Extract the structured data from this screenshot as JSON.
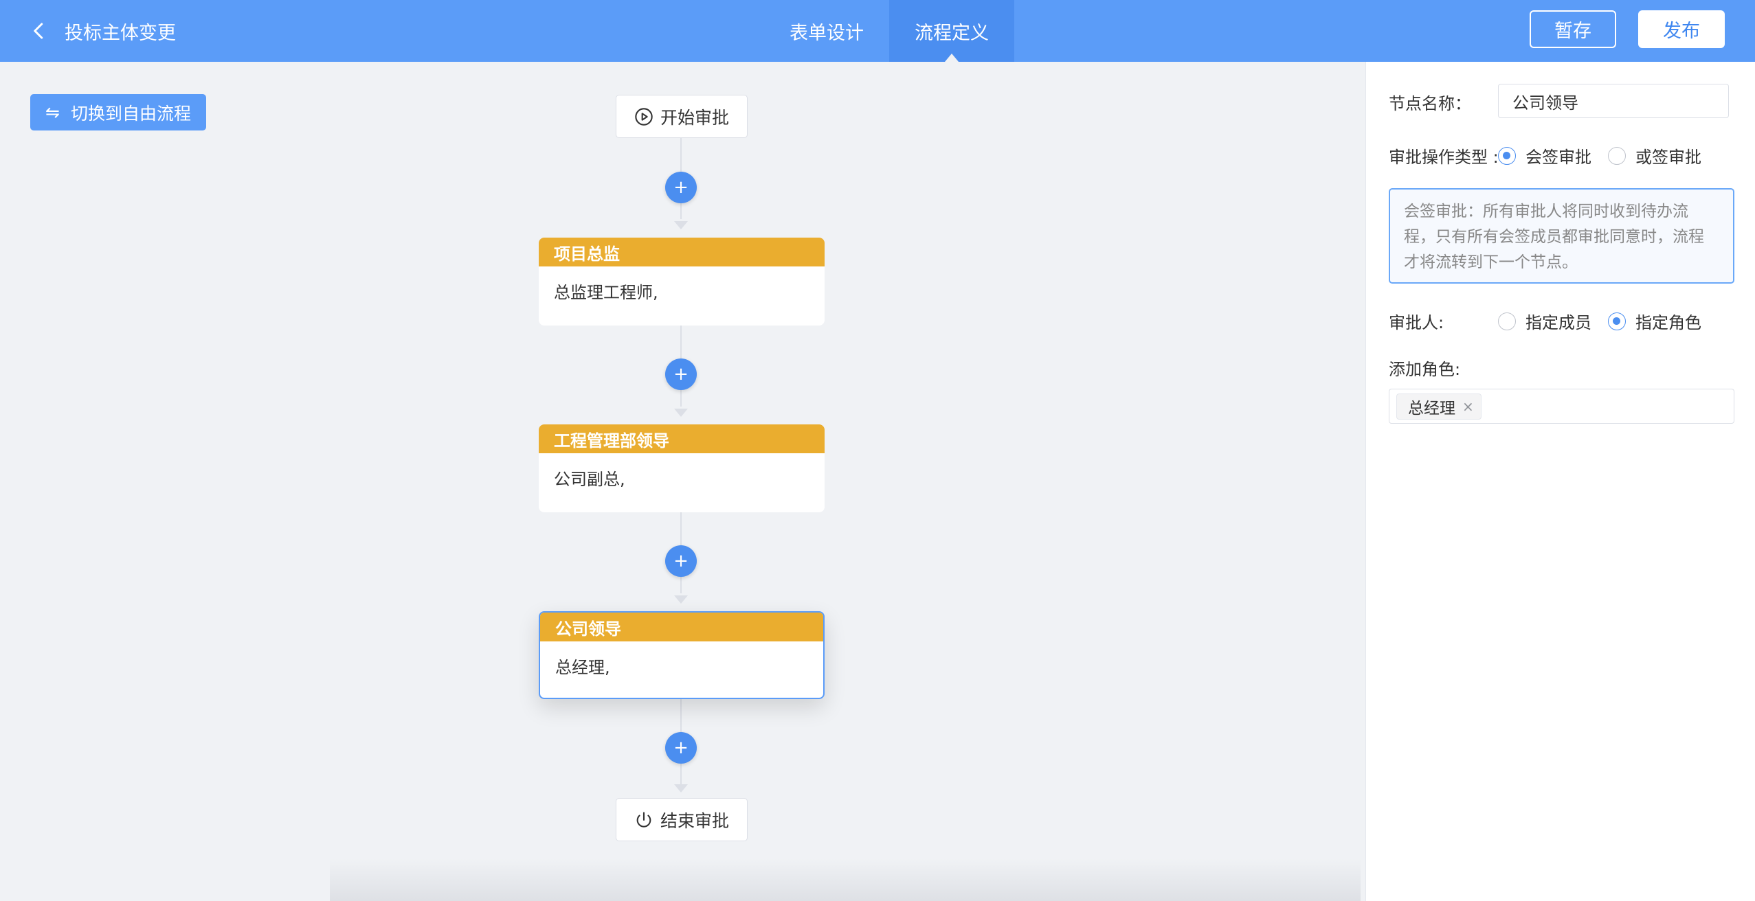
{
  "header": {
    "title": "投标主体变更",
    "tabs": [
      {
        "label": "表单设计",
        "active": false
      },
      {
        "label": "流程定义",
        "active": true
      }
    ],
    "save_label": "暂存",
    "publish_label": "发布"
  },
  "canvas": {
    "switch_label": "切换到自由流程",
    "start_label": "开始审批",
    "end_label": "结束审批",
    "add_symbol": "+",
    "nodes": [
      {
        "title": "项目总监",
        "body": "总监理工程师,",
        "selected": false
      },
      {
        "title": "工程管理部领导",
        "body": "公司副总,",
        "selected": false
      },
      {
        "title": "公司领导",
        "body": "总经理,",
        "selected": true
      }
    ]
  },
  "panel": {
    "node_name_label": "节点名称：",
    "node_name_value": "公司领导",
    "approval_type_label": "审批操作类型 :",
    "approval_type_options": [
      {
        "label": "会签审批",
        "checked": true
      },
      {
        "label": "或签审批",
        "checked": false
      }
    ],
    "description": "会签审批：所有审批人将同时收到待办流程，只有所有会签成员都审批同意时，流程才将流转到下一个节点。",
    "approver_label": "审批人:",
    "approver_options": [
      {
        "label": "指定成员",
        "checked": false
      },
      {
        "label": "指定角色",
        "checked": true
      }
    ],
    "add_role_label": "添加角色:",
    "roles": [
      "总经理"
    ],
    "remove_symbol": "×"
  },
  "colors": {
    "primary": "#5b9cf8",
    "active_tab": "#4b8ef0",
    "node_header": "#eaad2f",
    "background": "#f0f2f5"
  },
  "icons": {
    "back": "chevron-left-icon",
    "switch": "swap-arrows-icon",
    "start": "play-circle-icon",
    "end": "power-icon",
    "add": "plus-icon",
    "remove": "close-icon"
  }
}
